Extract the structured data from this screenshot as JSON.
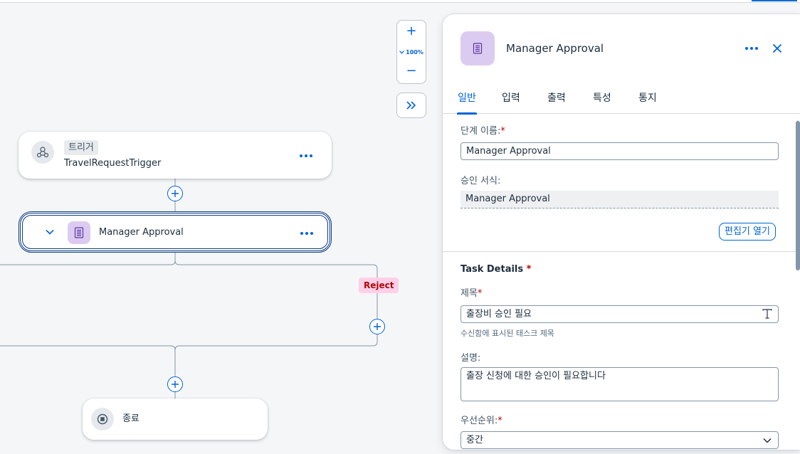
{
  "canvas": {
    "zoom": {
      "zoom_in": "+",
      "level": "100%",
      "zoom_out": "−"
    },
    "trigger_node": {
      "badge": "트리거",
      "name": "TravelRequestTrigger"
    },
    "approval_node": {
      "name": "Manager Approval"
    },
    "reject_label": "Reject",
    "end_node": {
      "name": "종료"
    }
  },
  "panel": {
    "title": "Manager Approval",
    "tabs": [
      {
        "label": "일반",
        "active": true
      },
      {
        "label": "입력"
      },
      {
        "label": "출력"
      },
      {
        "label": "특성"
      },
      {
        "label": "통지"
      }
    ],
    "step_name_label": "단계 이름:",
    "step_name_value": "Manager Approval",
    "approval_form_label": "승인 서식:",
    "approval_form_value": "Manager Approval",
    "open_editor_label": "편집기 열기",
    "task_details_title": "Task Details",
    "subject_label": "제목",
    "subject_value": "출장비 승인 필요",
    "subject_hint": "수신함에 표시된 태스크 제목",
    "description_label": "설명:",
    "description_value": "출장 신청에 대한 승인이 필요합니다",
    "priority_label": "우선순위:",
    "priority_value": "중간",
    "required_mark": "*"
  },
  "colors": {
    "accent": "#0064d9",
    "approval_icon_bg": "#dccbf0",
    "reject_bg": "#ffd0e7",
    "reject_text": "#aa0808"
  },
  "icons": {
    "trigger": "trigger-network-icon",
    "approval": "form-document-icon",
    "end": "stop-circle-icon",
    "add": "add-circle-icon",
    "more": "more-dots-icon",
    "close": "close-icon",
    "expand": "double-chevron-right-icon",
    "collapse": "chevron-down-icon",
    "text_format": "text-format-icon",
    "dropdown": "chevron-down-icon"
  }
}
